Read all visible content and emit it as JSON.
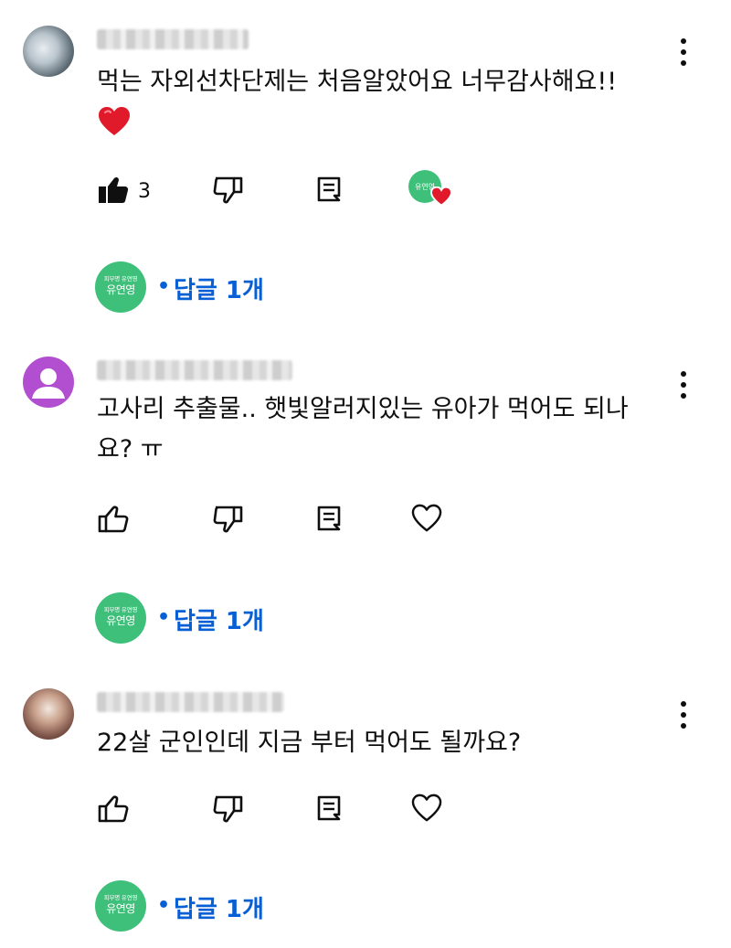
{
  "comments": [
    {
      "text_lines": [
        "먹는 자외선차단제는 처음알았어요 너무감사해요!!"
      ],
      "has_heart_emoji": true,
      "like_count": "3",
      "liked": true,
      "creator_hearted": true,
      "replies_label": "답글 1개"
    },
    {
      "text_lines": [
        "고사리 추출물.. 햇빛알러지있는 유아가 먹어도 되나",
        "요? ㅠ"
      ],
      "has_heart_emoji": false,
      "like_count": "",
      "liked": false,
      "creator_hearted": false,
      "replies_label": "답글 1개"
    },
    {
      "text_lines": [
        "22살 군인인데 지금 부터 먹어도 될까요?"
      ],
      "has_heart_emoji": false,
      "like_count": "",
      "liked": false,
      "creator_hearted": false,
      "replies_label": "답글 1개"
    }
  ],
  "channel_avatar": {
    "top_text": "피부명 유연영",
    "main_text": "유연영"
  },
  "colors": {
    "link_blue": "#065fd4",
    "channel_green": "#3ec07a",
    "heart_red": "#e0192b",
    "avatar_purple": "#b14fd0"
  },
  "icons": [
    "more-vert-icon",
    "thumb-up-icon",
    "thumb-down-icon",
    "reply-icon",
    "heart-icon"
  ]
}
